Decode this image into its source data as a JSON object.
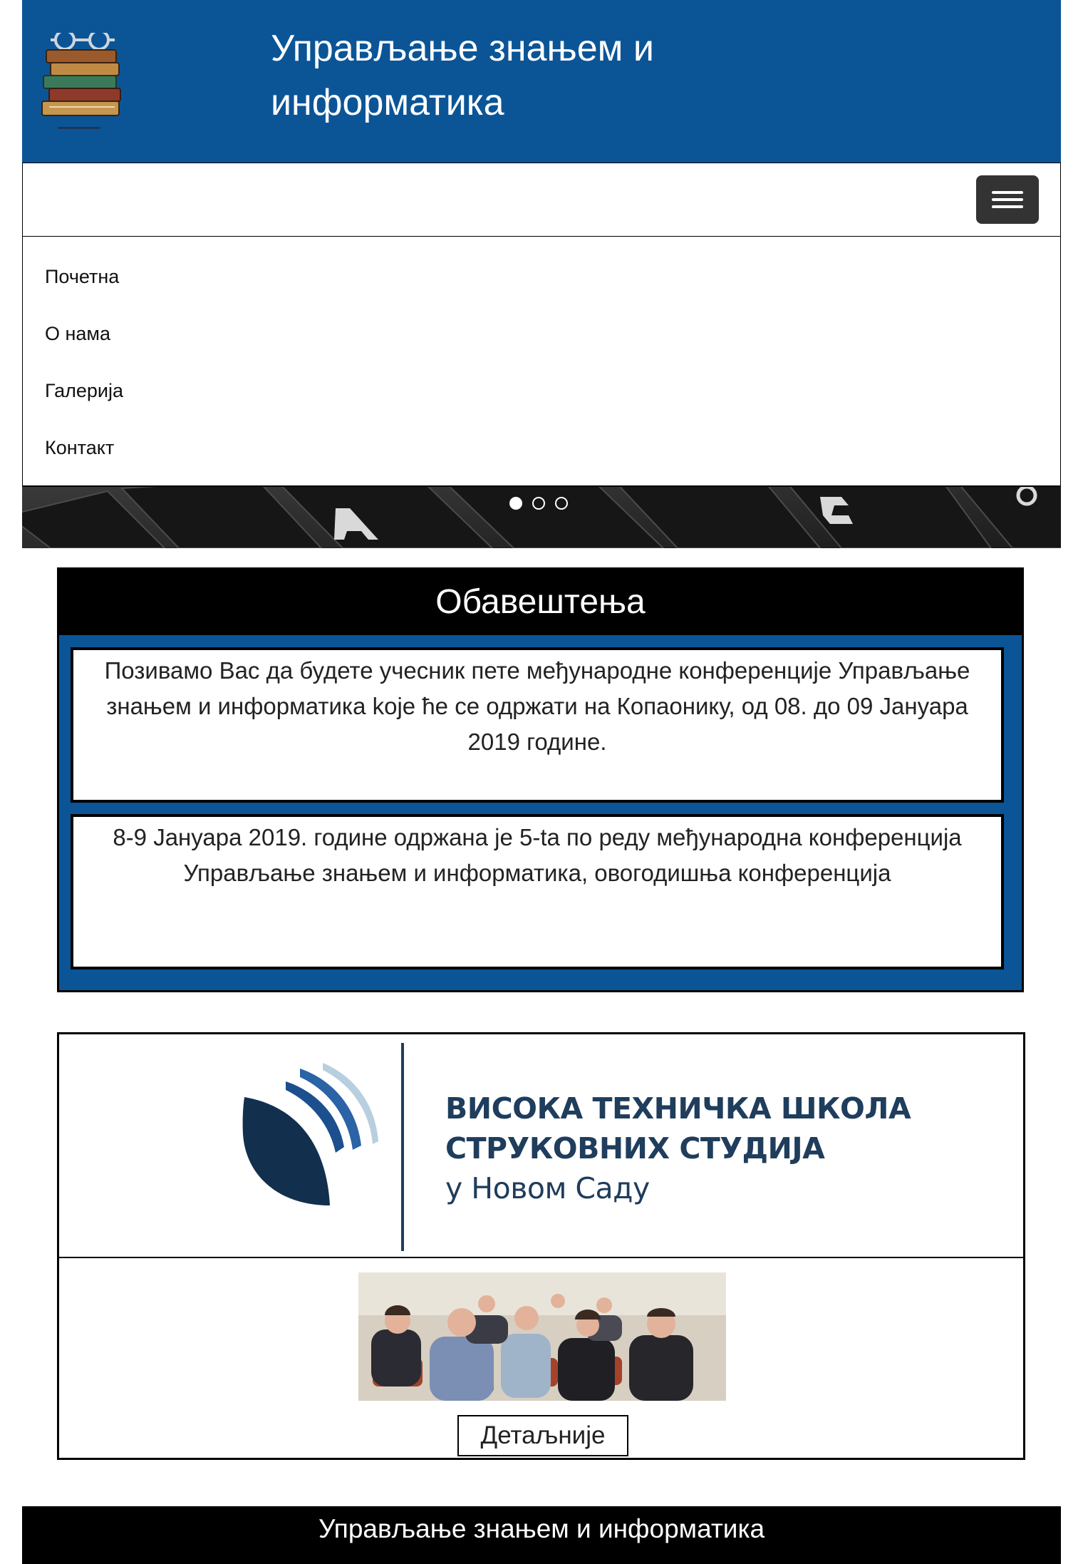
{
  "header": {
    "title": "Управљање знањем и информатика",
    "logo_icon": "book-stack-with-glasses-icon",
    "brand_color": "#0b5597"
  },
  "navbar": {
    "toggle_icon": "hamburger-menu-icon"
  },
  "menu": {
    "items": [
      {
        "label": "Почетна"
      },
      {
        "label": "О нама"
      },
      {
        "label": "Галерија"
      },
      {
        "label": "Контакт"
      }
    ]
  },
  "carousel": {
    "slide_count": 3,
    "active_slide": 1,
    "image": "keyboard-keys-photo"
  },
  "notices": {
    "heading": "Обавештења",
    "items": [
      {
        "text": "Позивамо Вас да будете учесник пете међународне конференције Управљање знањем и информатика koje ће се одржати на Копаонику, од 08. до 09 Јануара 2019 године."
      },
      {
        "text": "8-9 Јануара 2019. године одржана је 5-ta по реду међународна конференција Управљање знањем и информатика, овогодишња конференција"
      }
    ]
  },
  "partner": {
    "school_lines": [
      "ВИСОКА ТЕХНИЧКА ШКОЛА",
      "СТРУКОВНИХ СТУДИЈА",
      "у Новом Саду"
    ],
    "school_logo_icon": "leaf-emblem-icon",
    "photo": "conference-audience-photo",
    "details_label": "Детаљније"
  },
  "footer": {
    "text": "Управљање знањем и информатика"
  }
}
